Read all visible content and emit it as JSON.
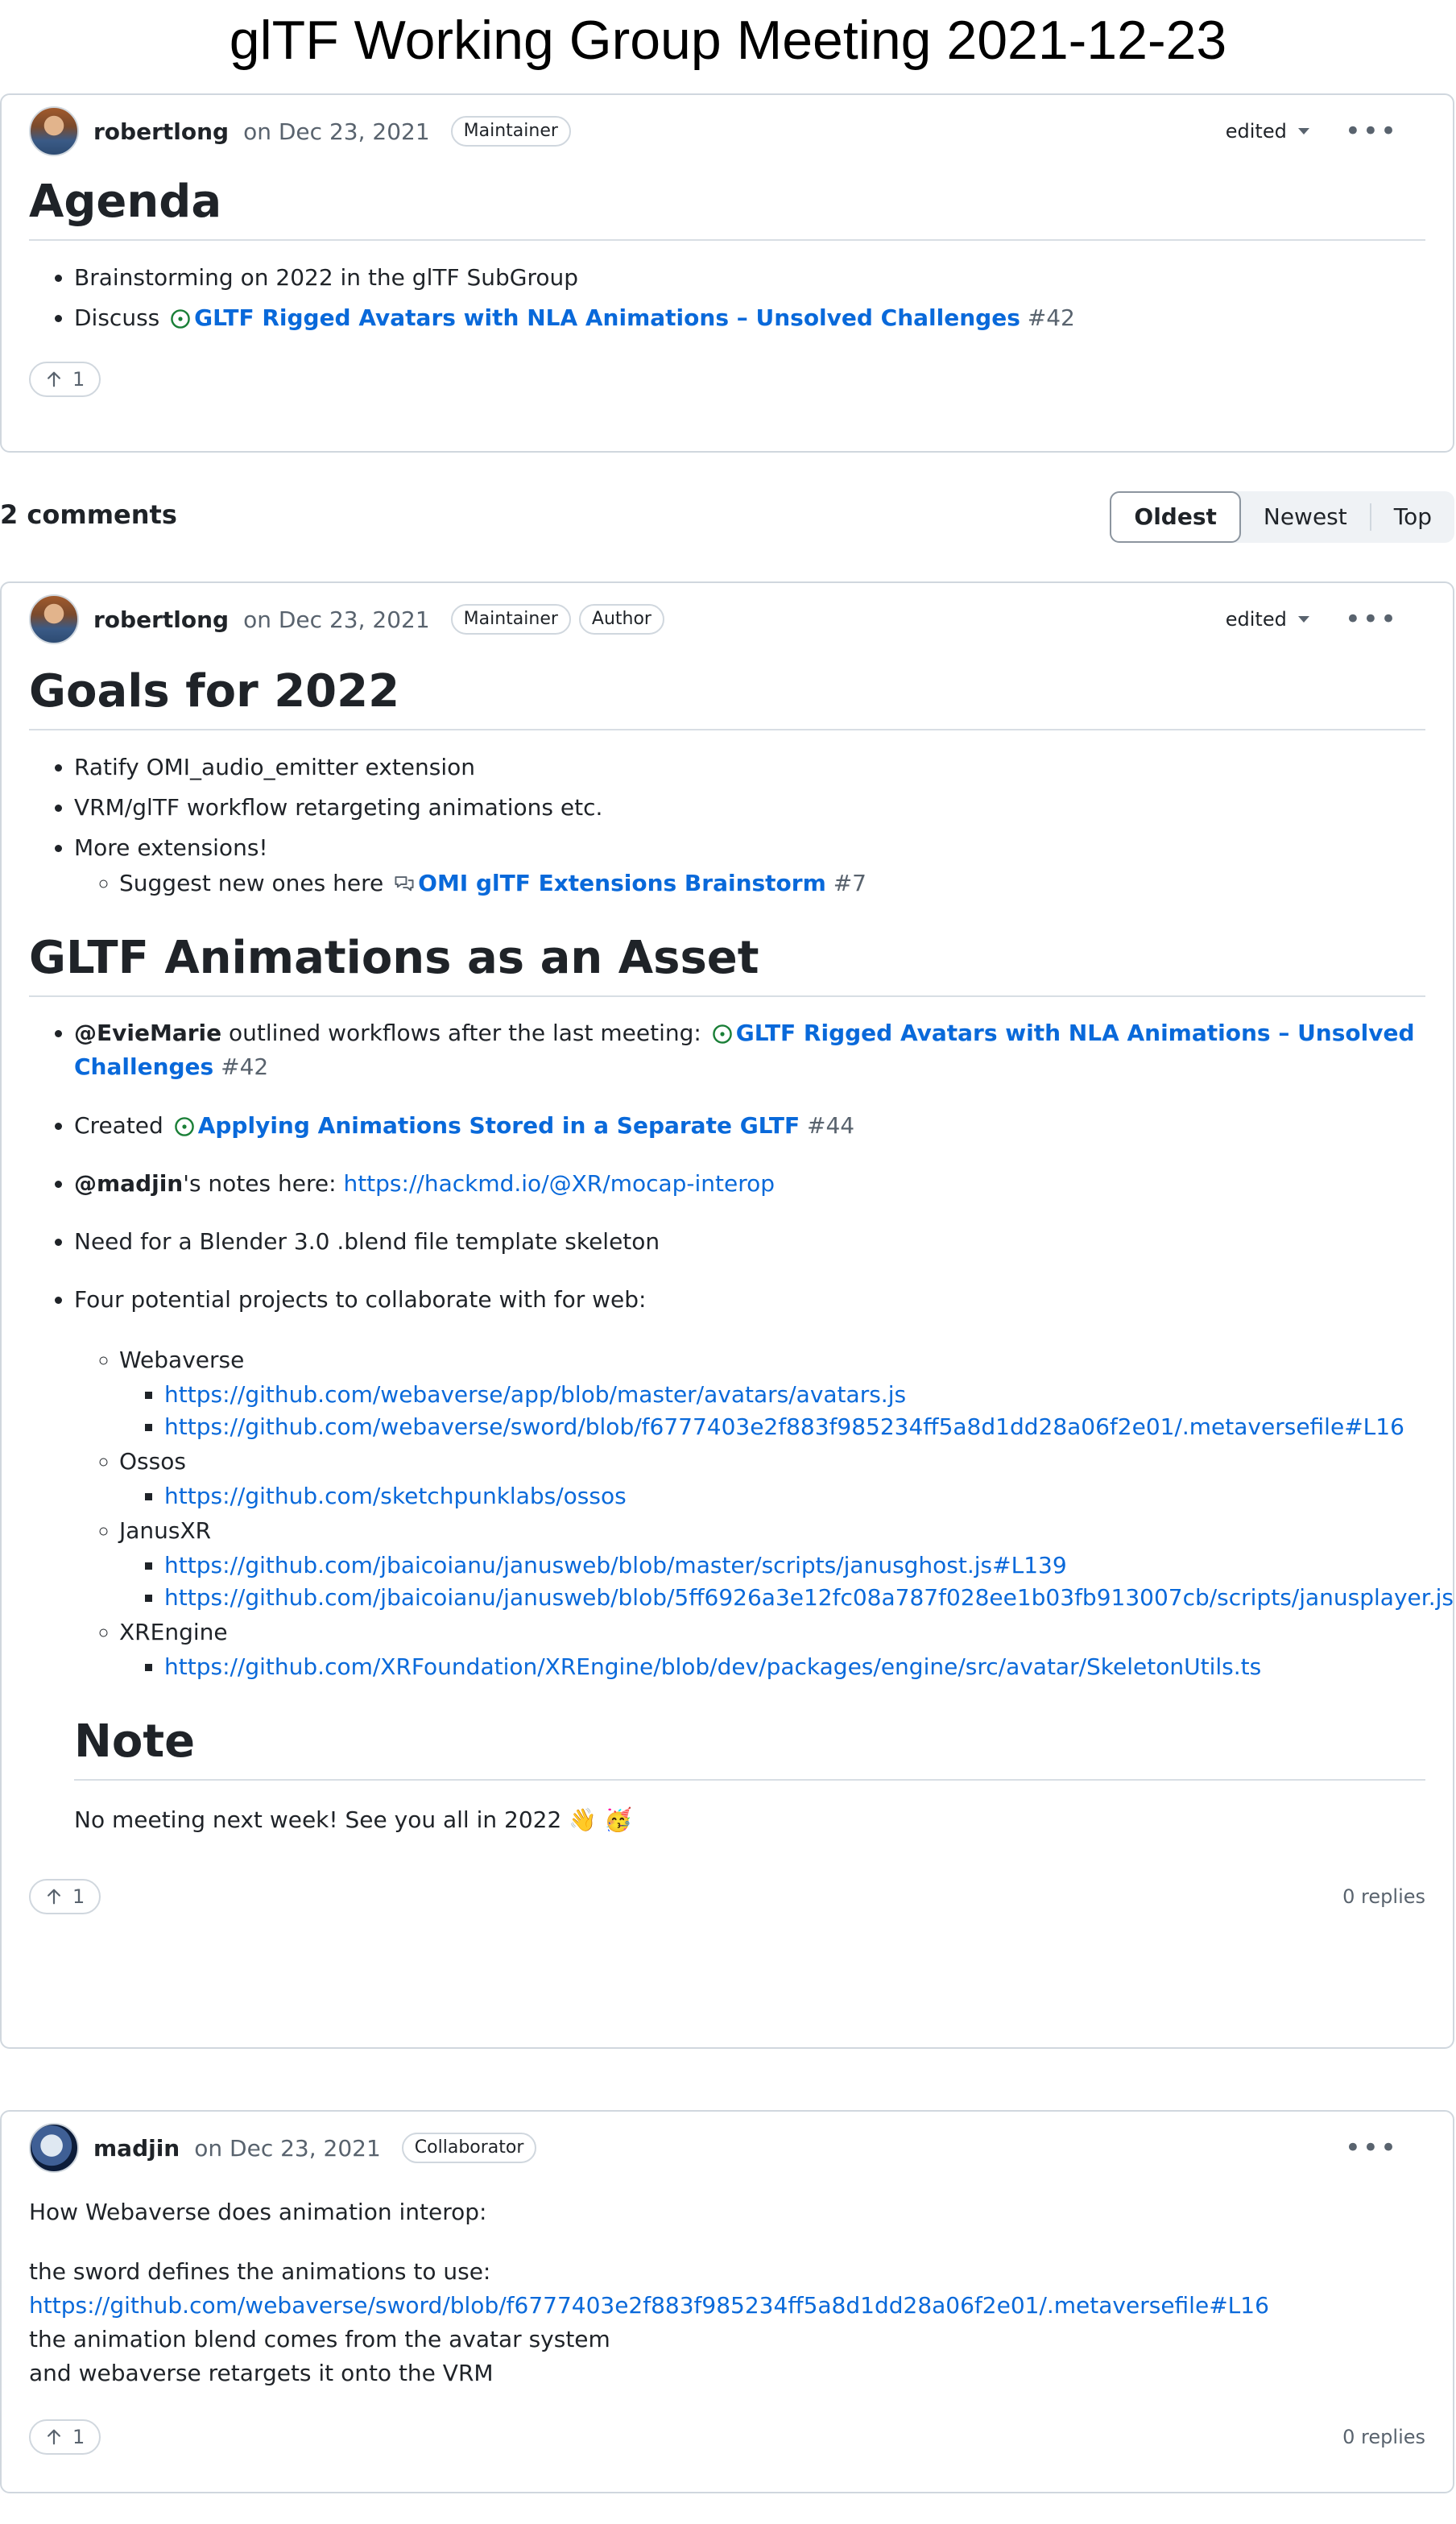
{
  "page": {
    "title": "glTF Working Group Meeting 2021-12-23"
  },
  "post": {
    "author": "robertlong",
    "date": "on Dec 23, 2021",
    "badges": [
      "Maintainer"
    ],
    "edited": "edited",
    "heading": "Agenda",
    "items": {
      "i0": "Brainstorming on 2022 in the glTF SubGroup",
      "i1_pre": "Discuss",
      "i1_link": "GLTF Rigged Avatars with NLA Animations – Unsolved Challenges",
      "i1_num": "#42"
    },
    "upvotes": "1"
  },
  "comments_bar": {
    "count": "2 comments",
    "sort_options": [
      "Oldest",
      "Newest",
      "Top"
    ],
    "active_sort": "Oldest"
  },
  "comment1": {
    "author": "robertlong",
    "date": "on Dec 23, 2021",
    "badges": [
      "Maintainer",
      "Author"
    ],
    "edited": "edited",
    "h_goals": "Goals for 2022",
    "goals": {
      "g0": "Ratify OMI_audio_emitter extension",
      "g1": "VRM/glTF workflow retargeting animations etc.",
      "g2": "More extensions!",
      "g2_sub_pre": "Suggest new ones here",
      "g2_sub_link": "OMI glTF Extensions Brainstorm",
      "g2_sub_num": "#7"
    },
    "h_anim": "GLTF Animations as an Asset",
    "anim": {
      "a0_mention": "@EvieMarie",
      "a0_text": "outlined workflows after the last meeting:",
      "a0_link": "GLTF Rigged Avatars with NLA Animations – Unsolved Challenges",
      "a0_num": "#42",
      "a1_pre": "Created",
      "a1_link": "Applying Animations Stored in a Separate GLTF",
      "a1_num": "#44",
      "a2_mention": "@madjin",
      "a2_text": "'s notes here:",
      "a2_link": "https://hackmd.io/@XR/mocap-interop",
      "a3": "Need for a Blender 3.0 .blend file template skeleton",
      "a4": "Four potential projects to collaborate with for web:"
    },
    "projects": {
      "p0": "Webaverse",
      "p0_l0": "https://github.com/webaverse/app/blob/master/avatars/avatars.js",
      "p0_l1": "https://github.com/webaverse/sword/blob/f6777403e2f883f985234ff5a8d1dd28a06f2e01/.metaversefile#L16",
      "p1": "Ossos",
      "p1_l0": "https://github.com/sketchpunklabs/ossos",
      "p2": "JanusXR",
      "p2_l0": "https://github.com/jbaicoianu/janusweb/blob/master/scripts/janusghost.js#L139",
      "p2_l1": "https://github.com/jbaicoianu/janusweb/blob/5ff6926a3e12fc08a787f028ee1b03fb913007cb/scripts/janusplayer.js",
      "p3": "XREngine",
      "p3_l0": "https://github.com/XRFoundation/XREngine/blob/dev/packages/engine/src/avatar/SkeletonUtils.ts"
    },
    "h_note": "Note",
    "note": "No meeting next week! See you all in 2022 👋 🥳",
    "upvotes": "1",
    "replies": "0 replies"
  },
  "comment2": {
    "author": "madjin",
    "date": "on Dec 23, 2021",
    "badges": [
      "Collaborator"
    ],
    "p0": "How Webaverse does animation interop:",
    "p1": "the sword defines the animations to use:",
    "p1_link": "https://github.com/webaverse/sword/blob/f6777403e2f883f985234ff5a8d1dd28a06f2e01/.metaversefile#L16",
    "p2": "the animation blend comes from the avatar system",
    "p3": "and webaverse retargets it onto the VRM",
    "upvotes": "1",
    "replies": "0 replies"
  },
  "colors": {
    "link": "#0969da",
    "open_issue": "#1a7f37",
    "border": "#d0d7de",
    "muted": "#59636e"
  }
}
